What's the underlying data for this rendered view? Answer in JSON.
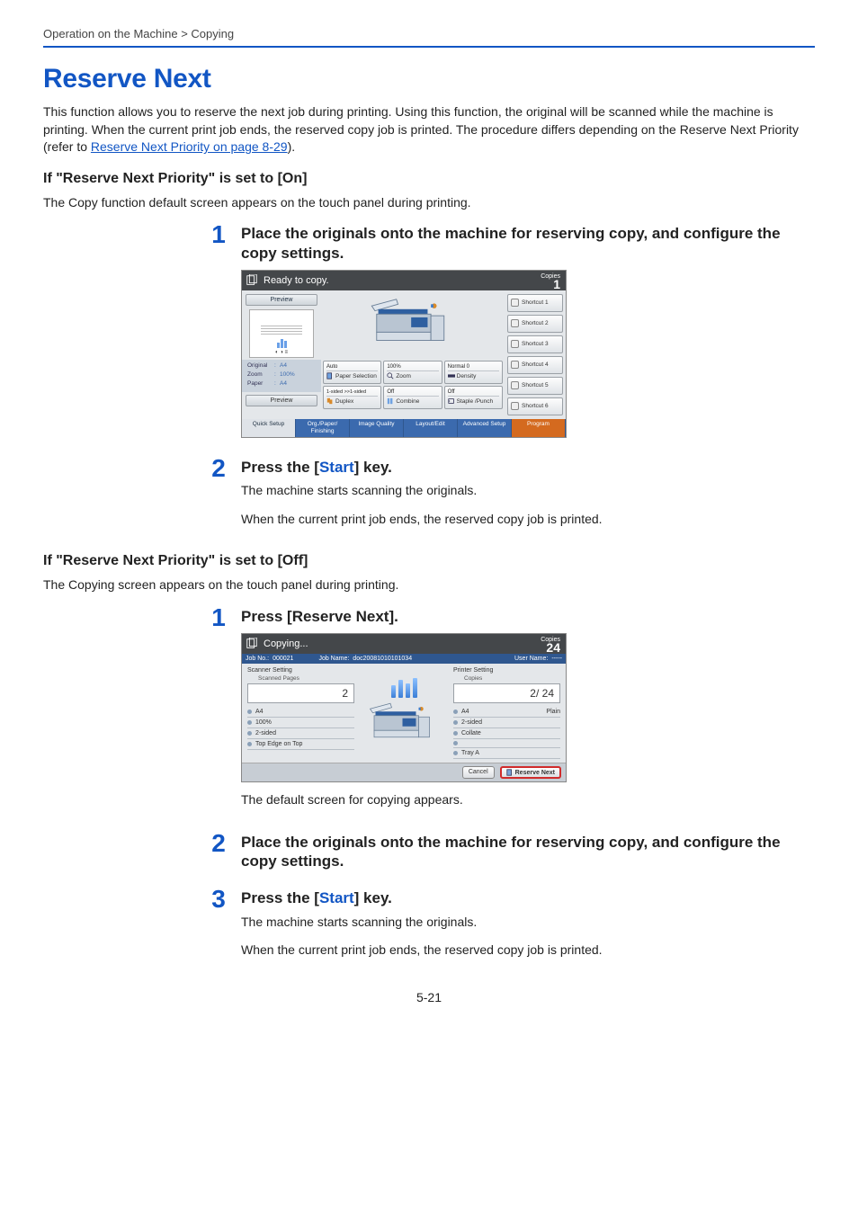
{
  "breadcrumb": "Operation on the Machine > Copying",
  "title": "Reserve Next",
  "intro_a": "This function allows you to reserve the next job during printing. Using this function, the original will be scanned while the machine is printing. When the current print job ends, the reserved copy job is printed. The procedure differs depending on the Reserve Next Priority (refer to ",
  "intro_link": "Reserve Next Priority on page 8-29",
  "intro_b": ").",
  "sect_on": {
    "heading": "If \"Reserve Next Priority\" is set to [On]",
    "lead": "The Copy function default screen appears on the touch panel during printing.",
    "step1_num": "1",
    "step1_title": "Place the originals onto the machine for reserving copy, and configure the copy settings.",
    "step2_num": "2",
    "step2_title_a": "Press the [",
    "step2_title_b": "Start",
    "step2_title_c": "] key.",
    "step2_line1": "The machine starts scanning the originals.",
    "step2_line2": "When the current print job ends, the reserved copy job is printed."
  },
  "panel1": {
    "status": "Ready to copy.",
    "copies_label": "Copies",
    "copies_value": "1",
    "preview_tab": "Preview",
    "original_k": "Original",
    "original_v": "A4",
    "zoom_k": "Zoom",
    "zoom_v": "100%",
    "paper_k": "Paper",
    "paper_v": "A4",
    "preview_btn": "Preview",
    "btns": {
      "r1c1_h": "Auto",
      "r1c1_l": "Paper Selection",
      "r1c2_h": "100%",
      "r1c2_l": "Zoom",
      "r1c3_h": "Normal 0",
      "r1c3_l": "Density",
      "r2c1_h": "1-sided >>1-sided",
      "r2c1_l": "Duplex",
      "r2c2_h": "Off",
      "r2c2_l": "Combine",
      "r2c3_h": "Off",
      "r2c3_l": "Staple /Punch"
    },
    "shortcuts": [
      "Shortcut 1",
      "Shortcut 2",
      "Shortcut 3",
      "Shortcut 4",
      "Shortcut 5",
      "Shortcut 6"
    ],
    "tabs": [
      "Quick Setup",
      "Org./Paper/ Finishing",
      "Image Quality",
      "Layout/Edit",
      "Advanced Setup",
      "Program"
    ]
  },
  "sect_off": {
    "heading": "If \"Reserve Next Priority\" is set to [Off]",
    "lead": "The Copying screen appears on the touch panel during printing.",
    "step1_num": "1",
    "step1_title": "Press [Reserve Next].",
    "post_line": "The default screen for copying appears.",
    "step2_num": "2",
    "step2_title": "Place the originals onto the machine for reserving copy, and configure the copy settings.",
    "step3_num": "3",
    "step3_title_a": "Press the [",
    "step3_title_b": "Start",
    "step3_title_c": "] key.",
    "step3_line1": "The machine starts scanning the originals.",
    "step3_line2": "When the current print job ends, the reserved copy job is printed."
  },
  "panel2": {
    "status": "Copying...",
    "copies_label": "Copies",
    "copies_value": "24",
    "job_no_k": "Job No.:",
    "job_no_v": "000021",
    "job_name_k": "Job Name:",
    "job_name_v": "doc20081010101034",
    "user_name_k": "User Name:",
    "user_name_v": "-----",
    "scanner_setting": "Scanner Setting",
    "scanned_pages": "Scanned Pages",
    "scanned_value": "2",
    "scan_rows": [
      "A4",
      "100%",
      "2-sided",
      "Top Edge on Top"
    ],
    "printer_setting": "Printer Setting",
    "copies_sub": "Copies",
    "progress_value": "2/   24",
    "print_rows": [
      {
        "a": "A4",
        "b": "Plain"
      },
      {
        "a": "2-sided",
        "b": ""
      },
      {
        "a": "Collate",
        "b": ""
      },
      {
        "a": "",
        "b": ""
      },
      {
        "a": "Tray A",
        "b": ""
      }
    ],
    "cancel": "Cancel",
    "reserve_next": "Reserve Next"
  },
  "page_num": "5-21"
}
